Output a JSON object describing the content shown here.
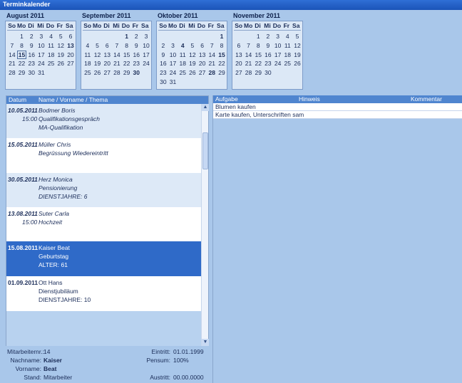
{
  "window": {
    "title": "Terminkalender"
  },
  "calendars": [
    {
      "title": "August 2011",
      "days": [
        "",
        "1",
        "2",
        "3",
        "4",
        "5",
        "6",
        "7",
        "8",
        "9",
        "10",
        "11",
        "12",
        "13",
        "14",
        "15",
        "16",
        "17",
        "18",
        "19",
        "20",
        "21",
        "22",
        "23",
        "24",
        "25",
        "26",
        "27",
        "28",
        "29",
        "30",
        "31"
      ],
      "bold": [
        "13",
        "15"
      ],
      "today": "15"
    },
    {
      "title": "September 2011",
      "days": [
        "",
        "",
        "",
        "",
        "1",
        "2",
        "3",
        "4",
        "5",
        "6",
        "7",
        "8",
        "9",
        "10",
        "11",
        "12",
        "13",
        "14",
        "15",
        "16",
        "17",
        "18",
        "19",
        "20",
        "21",
        "22",
        "23",
        "24",
        "25",
        "26",
        "27",
        "28",
        "29",
        "30"
      ],
      "bold": [
        "1",
        "30"
      ],
      "today": ""
    },
    {
      "title": "Oktober 2011",
      "days": [
        "",
        "",
        "",
        "",
        "",
        "",
        "1",
        "2",
        "3",
        "4",
        "5",
        "6",
        "7",
        "8",
        "9",
        "10",
        "11",
        "12",
        "13",
        "14",
        "15",
        "16",
        "17",
        "18",
        "19",
        "20",
        "21",
        "22",
        "23",
        "24",
        "25",
        "26",
        "27",
        "28",
        "29",
        "30",
        "31"
      ],
      "bold": [
        "1",
        "4",
        "15",
        "28"
      ],
      "today": ""
    },
    {
      "title": "November 2011",
      "days": [
        "",
        "",
        "1",
        "2",
        "3",
        "4",
        "5",
        "6",
        "7",
        "8",
        "9",
        "10",
        "11",
        "12",
        "13",
        "14",
        "15",
        "16",
        "17",
        "18",
        "19",
        "20",
        "21",
        "22",
        "23",
        "24",
        "25",
        "26",
        "27",
        "28",
        "29",
        "30"
      ],
      "bold": [],
      "today": ""
    }
  ],
  "weekdays": [
    "So",
    "Mo",
    "Di",
    "Mi",
    "Do",
    "Fr",
    "Sa"
  ],
  "list": {
    "headers": {
      "datum": "Datum",
      "name": "Name / Vorname / Thema"
    },
    "entries": [
      {
        "date": "10.05.2011",
        "time": "15:00",
        "lines": [
          "Bodmer Boris",
          "Qualifikationsgespräch",
          "MA-Qualifikation"
        ],
        "style": "odd",
        "italic": true
      },
      {
        "date": "15.05.2011",
        "time": "",
        "lines": [
          "Müller Chris",
          "Begrüssung Wiedereintritt"
        ],
        "style": "even",
        "italic": true
      },
      {
        "date": "30.05.2011",
        "time": "",
        "lines": [
          "Herz Monica",
          "Pensionierung",
          "DIENSTJAHRE: 6"
        ],
        "style": "odd",
        "italic": true
      },
      {
        "date": "13.08.2011",
        "time": "15:00",
        "lines": [
          "Suter Carla",
          "Hochzeit"
        ],
        "style": "even",
        "italic": true
      },
      {
        "date": "15.08.2011",
        "time": "",
        "lines": [
          "Kaiser Beat",
          "Geburtstag",
          "ALTER: 61"
        ],
        "style": "sel",
        "italic": false
      },
      {
        "date": "01.09.2011",
        "time": "",
        "lines": [
          "Ott Hans",
          "Dienstjubiläum",
          "DIENSTJAHRE: 10"
        ],
        "style": "even",
        "italic": false
      }
    ]
  },
  "detail": {
    "mitarbeiternr_label": "Mitarbeiternr.:",
    "mitarbeiternr": "14",
    "nachname_label": "Nachname:",
    "nachname": "Kaiser",
    "vorname_label": "Vorname:",
    "vorname": "Beat",
    "stand_label": "Stand:",
    "stand": "Mitarbeiter",
    "eintritt_label": "Eintritt:",
    "eintritt": "01.01.1999",
    "pensum_label": "Pensum:",
    "pensum": "100%",
    "austritt_label": "Austritt:",
    "austritt": "00.00.0000"
  },
  "tasks": {
    "headers": {
      "aufgabe": "Aufgabe",
      "hinweis": "Hinweis",
      "kommentar": "Kommentar"
    },
    "rows": [
      "Blumen kaufen",
      "Karte kaufen, Unterschriften sam"
    ]
  }
}
